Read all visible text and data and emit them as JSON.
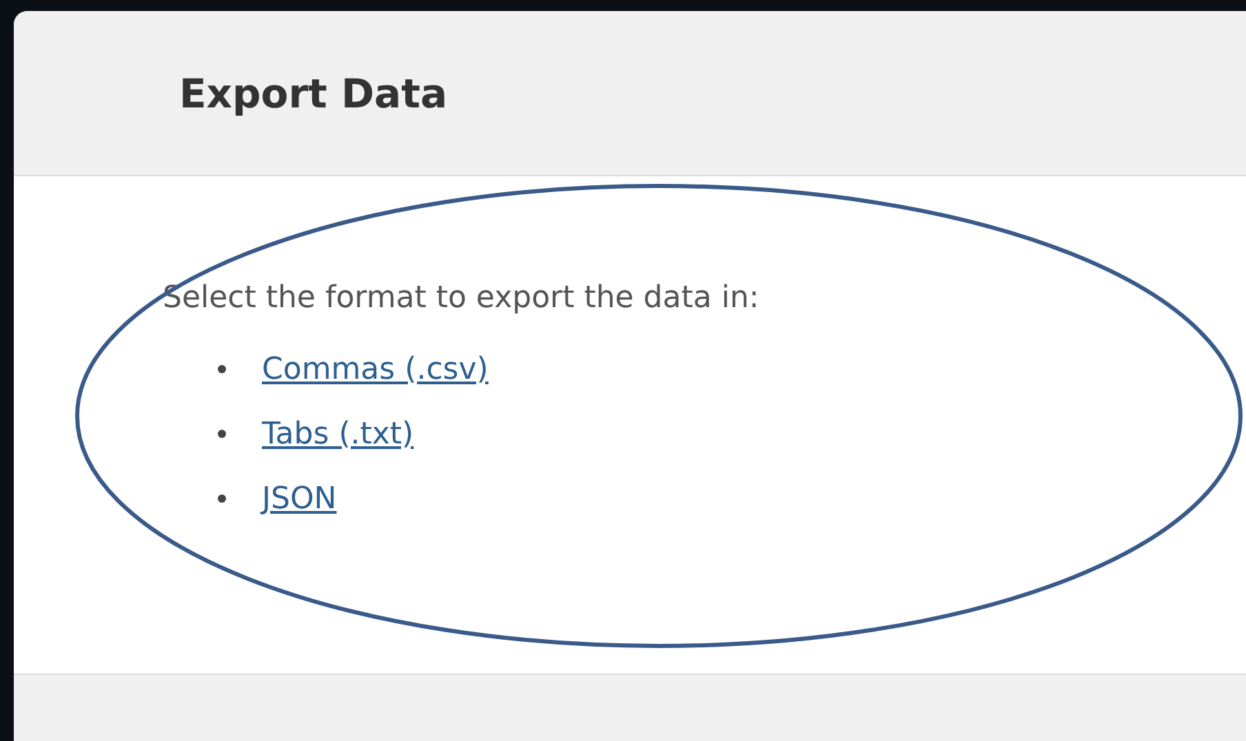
{
  "dialog": {
    "title": "Export Data",
    "prompt": "Select the format to export the data in:",
    "formats": [
      "Commas (.csv)",
      "Tabs (.txt)",
      "JSON"
    ]
  },
  "annotation": {
    "kind": "ellipse",
    "color": "#3a5a8a"
  }
}
